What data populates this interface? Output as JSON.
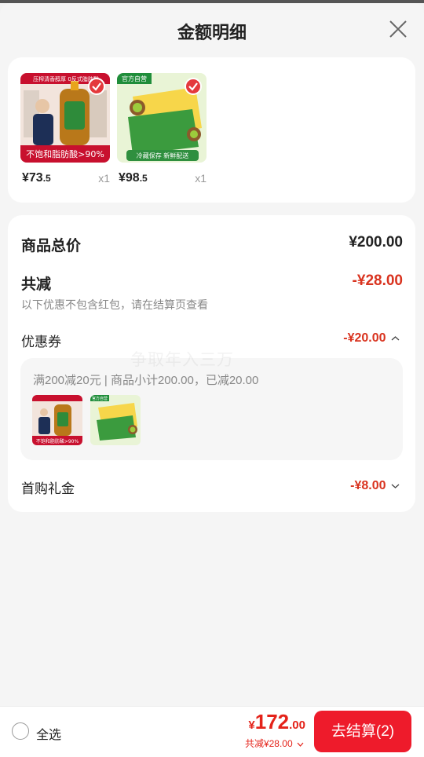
{
  "header": {
    "title": "金额明细"
  },
  "products": [
    {
      "price_int": "¥73",
      "price_dec": ".5",
      "qty": "x1",
      "image_banner_top": "压榨清香醇厚 0反式脂肪酸",
      "image_banner_bottom": "不饱和脂肪酸>90%"
    },
    {
      "price_int": "¥98",
      "price_dec": ".5",
      "qty": "x1",
      "image_tag": "官方自营",
      "image_banner_bottom": "冷藏保存 新鲜配送"
    }
  ],
  "summary": {
    "total_label": "商品总价",
    "total_value": "¥200.00",
    "discount_label": "共减",
    "discount_value": "-¥28.00",
    "note": "以下优惠不包含红包，请在结算页查看"
  },
  "coupon": {
    "label": "优惠券",
    "value": "-¥20.00",
    "description": "满200减20元 | 商品小计200.00，已减20.00",
    "mini_oil_text": "不饱和脂肪酸>90%",
    "mini_kiwi_tag": "官方自营"
  },
  "gift": {
    "label": "首购礼金",
    "value": "-¥8.00"
  },
  "watermark": "争取年入三万",
  "bottom_bar": {
    "select_all": "全选",
    "total_yen": "¥",
    "total_int": "172",
    "total_dec": ".00",
    "saved": "共减¥28.00",
    "checkout": "去结算(2)"
  },
  "colors": {
    "accent_red": "#e4231a",
    "discount_red": "#d9331f",
    "button_red": "#ee1b2b"
  }
}
